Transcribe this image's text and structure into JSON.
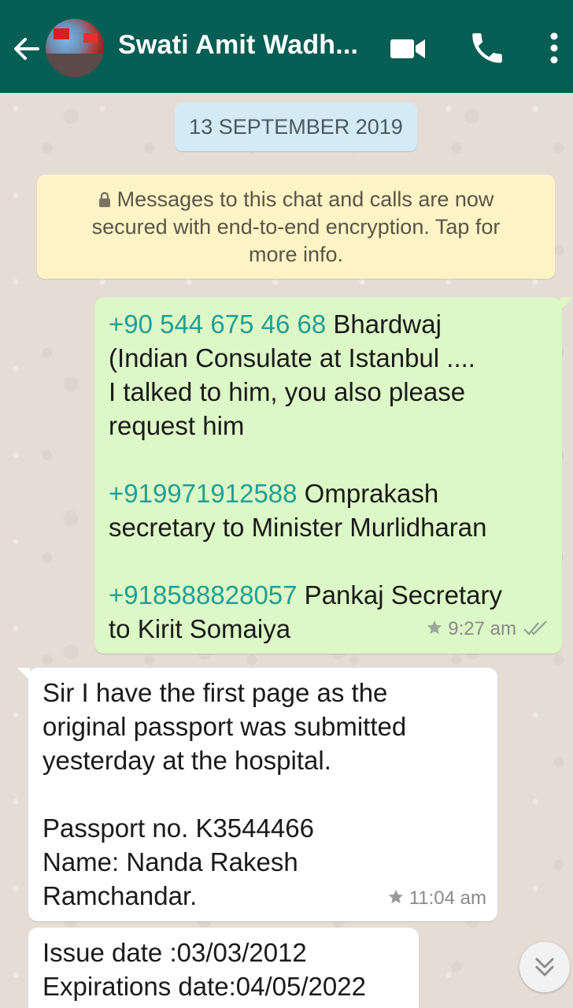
{
  "header": {
    "contact_name": "Swati Amit Wadh...",
    "back_icon": "arrow-left-icon",
    "video_icon": "videocam-icon",
    "call_icon": "phone-icon",
    "more_icon": "more-vertical-icon",
    "background": "#075e54"
  },
  "chat": {
    "date_label": "13 SEPTEMBER 2019",
    "encryption_notice": {
      "line1": "Messages to this chat and calls are now",
      "line2": "secured with end-to-end encryption. Tap for",
      "line3": "more info."
    },
    "messages": [
      {
        "direction": "outgoing",
        "para1": {
          "phone": "+90 544 675 46 68",
          "line1_rest": " Bhardwaj",
          "line2": "(Indian Consulate at Istanbul ....",
          "line3": "I talked to him, you also please",
          "line4": "request him"
        },
        "para2": {
          "phone": "+919971912588",
          "line1_rest": " Omprakash",
          "line2": "secretary to Minister Murlidharan"
        },
        "para3": {
          "phone": "+918588828057",
          "line1_rest": " Pankaj Secretary",
          "line2": "to Kirit Somaiya"
        },
        "time": "9:27 am",
        "starred": true,
        "status": "read"
      },
      {
        "direction": "incoming",
        "line1": "Sir I have the first page as the",
        "line2": "original passport was submitted",
        "line3": "yesterday at the hospital.",
        "line4": "Passport no. K3544466",
        "line5": "Name: Nanda Rakesh",
        "line6": "Ramchandar.",
        "time": "11:04 am",
        "starred": true
      },
      {
        "direction": "incoming",
        "line1": "Issue date :03/03/2012",
        "line2": "Expirations date:04/05/2022"
      }
    ],
    "scroll_down_icon": "double-chevron-down-icon"
  },
  "colors": {
    "outgoing_bubble": "#dcf8c6",
    "incoming_bubble": "#ffffff",
    "link": "#1e9f94",
    "chat_background": "#e5ddd5"
  }
}
